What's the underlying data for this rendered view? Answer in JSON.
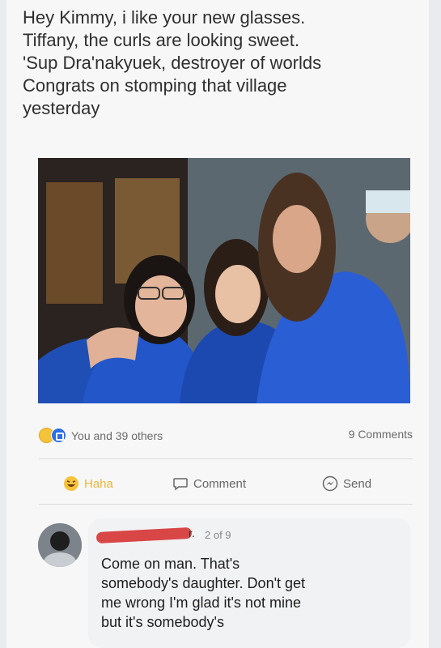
{
  "post": {
    "text": "Hey Kimmy, i like your new glasses.\nTiffany, the curls are looking sweet.\n'Sup Dra'nakyuek, destroyer of worlds\nCongrats on stomping that village\nyesterday"
  },
  "stats": {
    "reactions_label": "You and 39 others",
    "comments_label": "9 Comments"
  },
  "actions": {
    "haha_label": "Haha",
    "comment_label": "Comment",
    "send_label": "Send"
  },
  "comment": {
    "name_tail": "r.",
    "count": "2 of 9",
    "text": "Come on man. That's\nsomebody's daughter. Don't get\nme wrong I'm glad it's not mine\nbut it's somebody's"
  },
  "icons": {
    "reaction_haha": "haha-emoji-icon",
    "reaction_like": "like-icon",
    "comment_icon": "speech-bubble-icon",
    "send_icon": "messenger-icon"
  },
  "colors": {
    "haha": "#e8b63a",
    "like": "#2d6ee6",
    "redaction": "#d94646"
  }
}
